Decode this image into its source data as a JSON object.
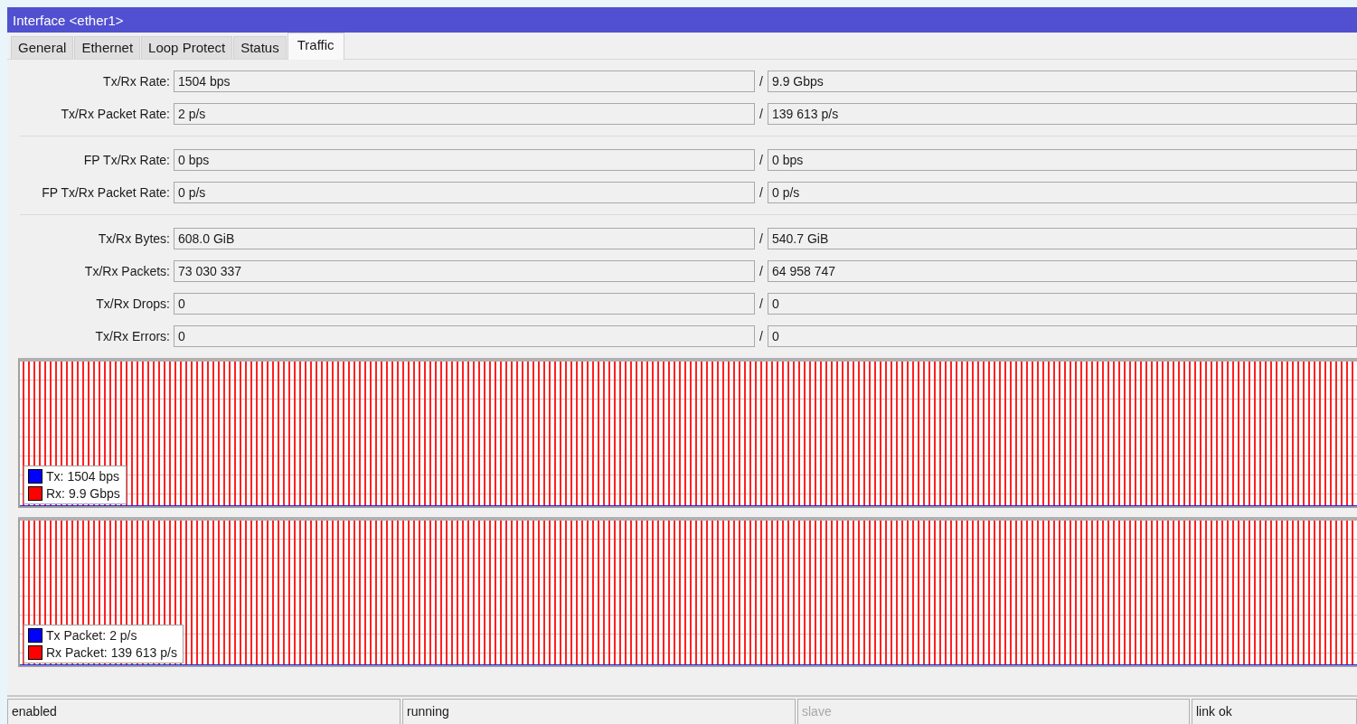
{
  "window": {
    "title": "Interface <ether1>"
  },
  "tabs": [
    {
      "label": "General",
      "selected": false
    },
    {
      "label": "Ethernet",
      "selected": false
    },
    {
      "label": "Loop Protect",
      "selected": false
    },
    {
      "label": "Status",
      "selected": false
    },
    {
      "label": "Traffic",
      "selected": true
    }
  ],
  "groups": [
    {
      "rows": [
        {
          "label": "Tx/Rx Rate:",
          "tx": "1504 bps",
          "separator": "/",
          "rx": "9.9 Gbps"
        },
        {
          "label": "Tx/Rx Packet Rate:",
          "tx": "2 p/s",
          "separator": "/",
          "rx": "139 613 p/s"
        }
      ]
    },
    {
      "rows": [
        {
          "label": "FP Tx/Rx Rate:",
          "tx": "0 bps",
          "separator": "/",
          "rx": "0 bps"
        },
        {
          "label": "FP Tx/Rx Packet Rate:",
          "tx": "0 p/s",
          "separator": "/",
          "rx": "0 p/s"
        }
      ]
    },
    {
      "rows": [
        {
          "label": "Tx/Rx Bytes:",
          "tx": "608.0 GiB",
          "separator": "/",
          "rx": "540.7 GiB"
        },
        {
          "label": "Tx/Rx Packets:",
          "tx": "73 030 337",
          "separator": "/",
          "rx": "64 958 747"
        },
        {
          "label": "Tx/Rx Drops:",
          "tx": "0",
          "separator": "/",
          "rx": "0"
        },
        {
          "label": "Tx/Rx Errors:",
          "tx": "0",
          "separator": "/",
          "rx": "0"
        }
      ]
    }
  ],
  "graphs": [
    {
      "legend": [
        {
          "label": "Tx:",
          "value": "1504 bps",
          "color": "#0000ff"
        },
        {
          "label": "Rx:",
          "value": "9.9 Gbps",
          "color": "#ff0000"
        }
      ]
    },
    {
      "legend": [
        {
          "label": "Tx Packet:",
          "value": "2 p/s",
          "color": "#0000ff"
        },
        {
          "label": "Rx Packet:",
          "value": "139 613 p/s",
          "color": "#ff0000"
        }
      ]
    }
  ],
  "status_bar": [
    {
      "text": "enabled",
      "disabled": false
    },
    {
      "text": "running",
      "disabled": false
    },
    {
      "text": "slave",
      "disabled": true
    },
    {
      "text": "link ok",
      "disabled": false
    }
  ]
}
